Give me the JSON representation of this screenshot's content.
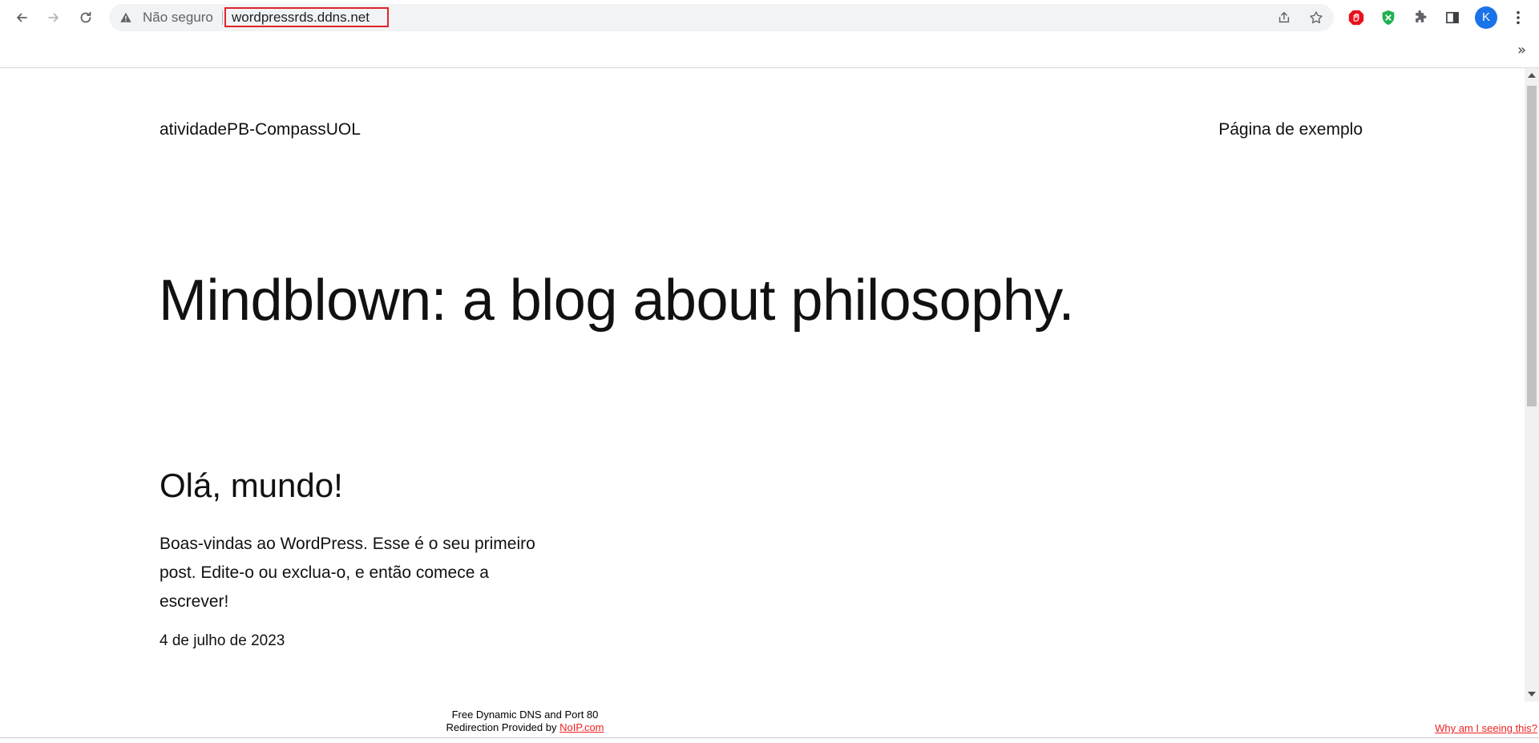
{
  "browser": {
    "security_label": "Não seguro",
    "url": "wordpressrds.ddns.net",
    "avatar_initial": "K",
    "more_bookmarks": "»",
    "colors": {
      "url_highlight": "#e3232c",
      "avatar": "#1a73e8",
      "adblock_ext": "#e8101c",
      "shield_ext": "#1fb150"
    },
    "icons": [
      "back-arrow-icon",
      "forward-arrow-icon",
      "reload-icon",
      "warning-icon",
      "share-icon",
      "star-icon",
      "adblock-extension-icon",
      "shield-extension-icon",
      "puzzle-extensions-icon",
      "side-panel-icon",
      "kebab-menu-icon"
    ]
  },
  "site": {
    "title": "atividadePB-CompassUOL",
    "nav_link": "Página de exemplo",
    "hero": "Mindblown: a blog about philosophy.",
    "post": {
      "title": "Olá, mundo!",
      "excerpt": "Boas-vindas ao WordPress. Esse é o seu primeiro post. Edite-o ou exclua-o, e então comece a escrever!",
      "date": "4 de julho de 2023"
    }
  },
  "footer": {
    "line1": "Free Dynamic DNS and Port 80",
    "line2_prefix": "Redirection Provided by ",
    "noip_link": "NoIP.com",
    "why_link": "Why am I seeing this?"
  }
}
